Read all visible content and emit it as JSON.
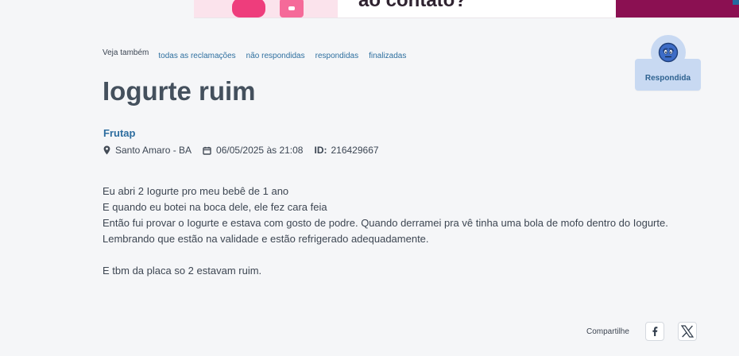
{
  "banner": {
    "text": "ao contato?"
  },
  "see_also": {
    "label": "Veja também",
    "links": [
      {
        "label": "todas as reclamações"
      },
      {
        "label": "não respondidas"
      },
      {
        "label": "respondidas"
      },
      {
        "label": "finalizadas"
      }
    ]
  },
  "complaint": {
    "title": "Iogurte ruim",
    "company": "Frutap",
    "location": "Santo Amaro - BA",
    "date": "06/05/2025 às 21:08",
    "id_label": "ID:",
    "id_value": "216429667",
    "body_lines": [
      "Eu abri 2 Iogurte pro meu bebê de 1 ano",
      "E quando eu botei na boca dele, ele fez cara feia",
      "Então fui provar o Iogurte e estava com gosto de podre. Quando derramei pra vê tinha uma bola de mofo dentro do Iogurte.",
      "Lembrando que estão na validade e estão refrigerado adequadamente.",
      "E tbm da placa so 2 estavam ruim."
    ],
    "status": {
      "label": "Respondida",
      "icon": "smiley-face-icon",
      "color": "#c8d9f2"
    }
  },
  "share": {
    "label": "Compartilhe",
    "buttons": [
      {
        "icon": "facebook-icon"
      },
      {
        "icon": "x-icon"
      }
    ]
  },
  "colors": {
    "background": "#f5f6f8",
    "title": "#44505d",
    "link": "#2e6f9f",
    "status_text": "#2e6290",
    "banner_magenta": "#8b1052",
    "banner_pink": "#fbe3ec"
  }
}
